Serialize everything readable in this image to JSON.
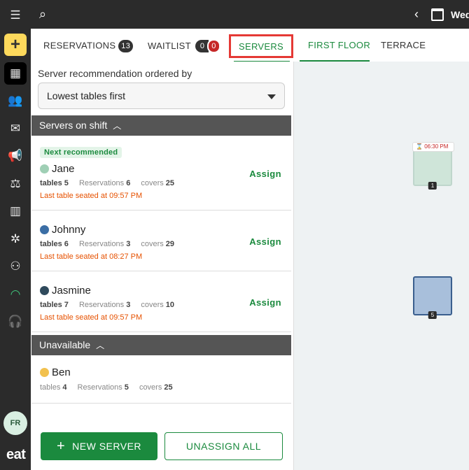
{
  "topbar": {
    "day_label": "Wed"
  },
  "sidebar": {
    "avatar_initials": "FR",
    "brand": "eat"
  },
  "tabs": {
    "reservations": {
      "label": "RESERVATIONS",
      "count": "13"
    },
    "waitlist": {
      "label": "WAITLIST",
      "count_a": "0",
      "count_b": "0"
    },
    "servers": {
      "label": "SERVERS"
    }
  },
  "floor_tabs": {
    "first_floor": "FIRST FLOOR",
    "terrace": "TERRACE"
  },
  "recommendation": {
    "label": "Server recommendation ordered by",
    "selected": "Lowest tables first"
  },
  "sections": {
    "on_shift": "Servers on shift",
    "unavailable": "Unavailable"
  },
  "labels": {
    "next_recommended": "Next recommended",
    "tables": "tables",
    "reservations": "Reservations",
    "covers": "covers",
    "assign": "Assign"
  },
  "servers_on_shift": [
    {
      "name": "Jane",
      "color": "#9fcfb5",
      "tables": "5",
      "reservations": "6",
      "covers": "25",
      "last_seated": "Last table seated at 09:57 PM"
    },
    {
      "name": "Johnny",
      "color": "#3b6ea5",
      "tables": "6",
      "reservations": "3",
      "covers": "29",
      "last_seated": "Last table seated at 08:27 PM"
    },
    {
      "name": "Jasmine",
      "color": "#2f4a5c",
      "tables": "7",
      "reservations": "3",
      "covers": "10",
      "last_seated": "Last table seated at 09:57 PM"
    }
  ],
  "servers_unavailable": [
    {
      "name": "Ben",
      "color": "#f2c14e",
      "tables": "4",
      "reservations": "5",
      "covers": "25"
    }
  ],
  "buttons": {
    "new_server": "NEW SERVER",
    "unassign_all": "UNASSIGN ALL"
  },
  "floor": {
    "tables": [
      {
        "number": "1",
        "time": "06:30 PM"
      },
      {
        "number": "5"
      }
    ]
  }
}
